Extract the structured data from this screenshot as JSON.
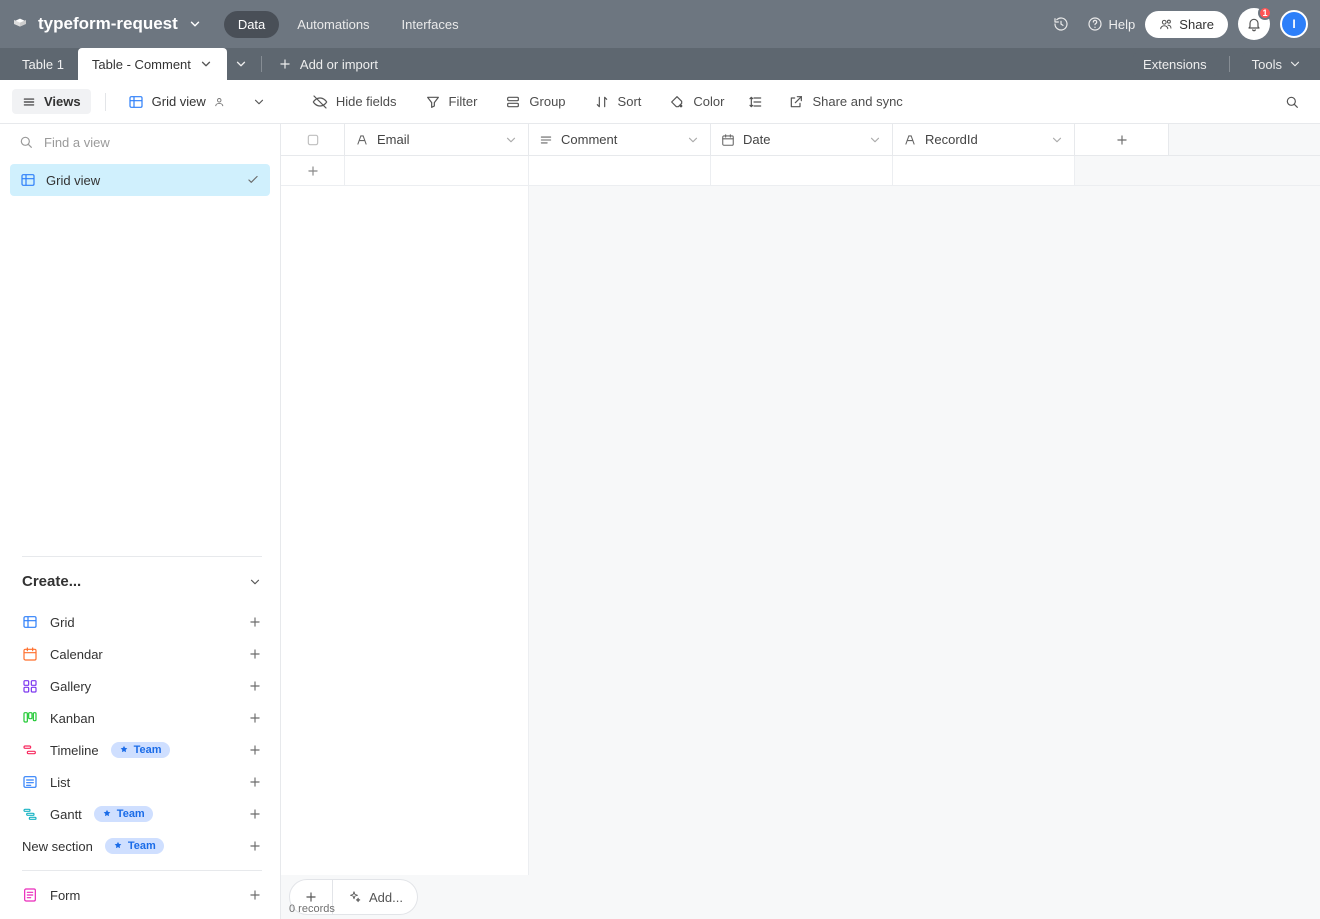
{
  "header": {
    "app_title": "typeform-request",
    "nav": {
      "data": "Data",
      "automations": "Automations",
      "interfaces": "Interfaces"
    },
    "help": "Help",
    "share": "Share",
    "notifications_count": "1",
    "avatar_initial": "I"
  },
  "tabs": {
    "items": [
      {
        "label": "Table 1"
      },
      {
        "label": "Table - Comment"
      }
    ],
    "add_or_import": "Add or import",
    "extensions": "Extensions",
    "tools": "Tools"
  },
  "toolbar": {
    "views": "Views",
    "grid_view": "Grid view",
    "hide_fields": "Hide fields",
    "filter": "Filter",
    "group": "Group",
    "sort": "Sort",
    "color": "Color",
    "share_sync": "Share and sync"
  },
  "sidebar": {
    "find_placeholder": "Find a view",
    "views": [
      {
        "label": "Grid view"
      }
    ],
    "create_header": "Create...",
    "create_items": [
      {
        "label": "Grid",
        "team": false,
        "icon": "grid",
        "color": "#2d7ff9"
      },
      {
        "label": "Calendar",
        "team": false,
        "icon": "calendar",
        "color": "#ff6f2c"
      },
      {
        "label": "Gallery",
        "team": false,
        "icon": "gallery",
        "color": "#7c37ef"
      },
      {
        "label": "Kanban",
        "team": false,
        "icon": "kanban",
        "color": "#20c933"
      },
      {
        "label": "Timeline",
        "team": true,
        "icon": "timeline",
        "color": "#f82b60"
      },
      {
        "label": "List",
        "team": false,
        "icon": "list",
        "color": "#2d7ff9"
      },
      {
        "label": "Gantt",
        "team": true,
        "icon": "gantt",
        "color": "#1ab4c4"
      },
      {
        "label": "New section",
        "team": true,
        "icon": "",
        "color": "#333333"
      }
    ],
    "team_label": "Team",
    "form_label": "Form"
  },
  "grid": {
    "columns": [
      {
        "label": "Email",
        "type": "text"
      },
      {
        "label": "Comment",
        "type": "longtext"
      },
      {
        "label": "Date",
        "type": "date"
      },
      {
        "label": "RecordId",
        "type": "formula"
      }
    ],
    "records_label": "0 records",
    "add_button": "Add..."
  }
}
